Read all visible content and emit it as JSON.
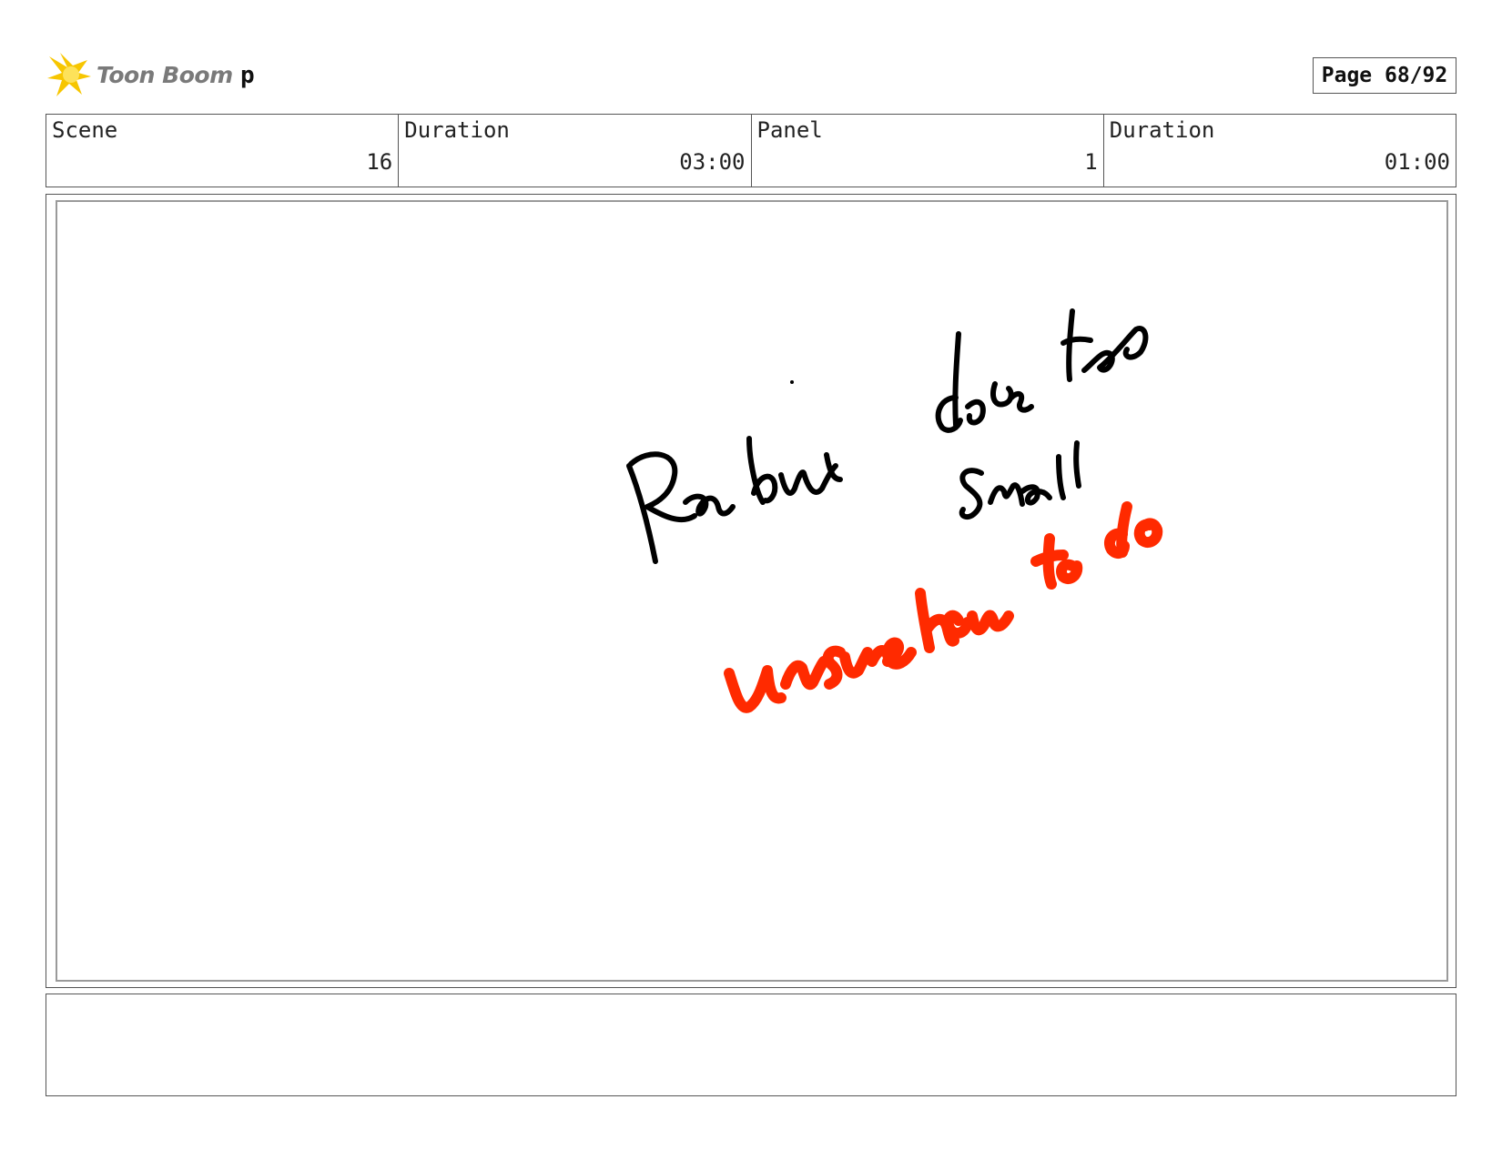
{
  "header": {
    "logo_text": "Toon Boom",
    "project_name": "p",
    "page_label": "Page 68/92"
  },
  "info": [
    {
      "label": "Scene",
      "value": "16"
    },
    {
      "label": "Duration",
      "value": "03:00"
    },
    {
      "label": "Panel",
      "value": "1"
    },
    {
      "label": "Duration",
      "value": "01:00"
    }
  ],
  "panel": {
    "handwriting_black": "Realize dose the small",
    "handwriting_red": "unsure how to do",
    "ink_colors": {
      "black": "#000000",
      "red": "#ff2a00"
    }
  },
  "notes": {
    "text": ""
  }
}
